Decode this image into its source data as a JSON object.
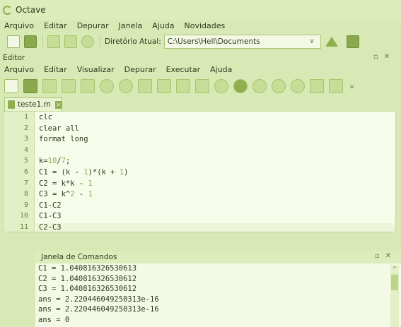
{
  "window": {
    "title": "Octave"
  },
  "menubar": {
    "items": [
      "Arquivo",
      "Editar",
      "Depurar",
      "Janela",
      "Ajuda",
      "Novidades"
    ]
  },
  "main_toolbar": {
    "dir_label": "Diretório Atual:",
    "dir_value": "C:\\Users\\Hell\\Documents"
  },
  "editor": {
    "title": "Editor",
    "menu": [
      "Arquivo",
      "Editar",
      "Visualizar",
      "Depurar",
      "Executar",
      "Ajuda"
    ],
    "tab": {
      "label": "teste1.m"
    },
    "lines": [
      {
        "n": "1",
        "parts": [
          [
            "t",
            "clc"
          ]
        ]
      },
      {
        "n": "2",
        "parts": [
          [
            "t",
            "clear all"
          ]
        ]
      },
      {
        "n": "3",
        "parts": [
          [
            "t",
            "format long"
          ]
        ]
      },
      {
        "n": "4",
        "parts": []
      },
      {
        "n": "5",
        "parts": [
          [
            "t",
            "k="
          ],
          [
            "num",
            "10"
          ],
          [
            "t",
            "/"
          ],
          [
            "num",
            "7"
          ],
          [
            "t",
            ";"
          ]
        ]
      },
      {
        "n": "6",
        "parts": [
          [
            "t",
            "C1 = (k - "
          ],
          [
            "num",
            "1"
          ],
          [
            "t",
            ")*(k + "
          ],
          [
            "num",
            "1"
          ],
          [
            "t",
            ")"
          ]
        ]
      },
      {
        "n": "7",
        "parts": [
          [
            "t",
            "C2 = k*k - "
          ],
          [
            "num",
            "1"
          ]
        ]
      },
      {
        "n": "8",
        "parts": [
          [
            "t",
            "C3 = k^"
          ],
          [
            "num",
            "2"
          ],
          [
            "t",
            " - "
          ],
          [
            "num",
            "1"
          ]
        ]
      },
      {
        "n": "9",
        "parts": [
          [
            "t",
            "C1-C2"
          ]
        ]
      },
      {
        "n": "10",
        "parts": [
          [
            "t",
            "C1-C3"
          ]
        ]
      },
      {
        "n": "11",
        "parts": [
          [
            "t",
            "C2-C3"
          ]
        ]
      }
    ]
  },
  "command_window": {
    "title": "Janela de Comandos",
    "output": [
      "C1 = 1.040816326530613",
      "C2 = 1.040816326530612",
      "C3 = 1.040816326530612",
      "ans = 2.220446049250313e-16",
      "ans = 2.220446049250313e-16",
      "ans = 0"
    ]
  },
  "colors": {
    "background": "#d9e9b6",
    "accent": "#8fae4f",
    "code_bg": "#f6fbea",
    "number_color": "#8fae4f"
  }
}
